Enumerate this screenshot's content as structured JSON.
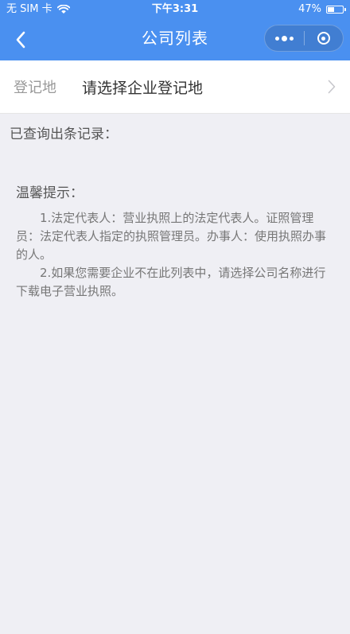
{
  "status_bar": {
    "carrier": "无 SIM 卡",
    "time": "下午3:31",
    "battery": "47%",
    "battery_level": 0.47
  },
  "nav": {
    "title": "公司列表"
  },
  "registration": {
    "label": "登记地",
    "value": "请选择企业登记地"
  },
  "records": {
    "text": "已查询出条记录："
  },
  "tips": {
    "title": "温馨提示：",
    "paragraphs": [
      "1.法定代表人：营业执照上的法定代表人。证照管理员：法定代表人指定的执照管理员。办事人：使用执照办事的人。",
      "2.如果您需要企业不在此列表中，请选择公司名称进行下载电子营业执照。"
    ]
  },
  "colors": {
    "header": "#4a90f0",
    "background": "#efeff4"
  },
  "icons": {
    "wifi": "wifi-icon",
    "battery": "battery-icon",
    "back": "back-arrow-icon",
    "more": "more-dots-icon",
    "close": "close-miniprogram-icon",
    "chevron": "chevron-right-icon"
  }
}
